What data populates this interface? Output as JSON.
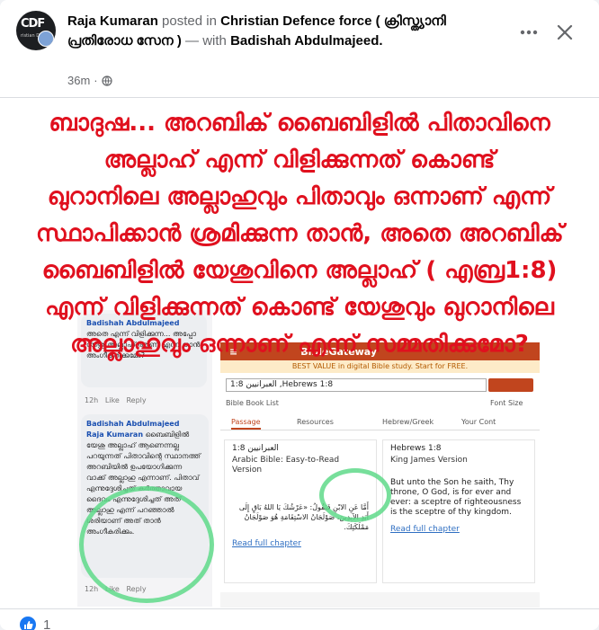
{
  "post": {
    "author": "Raja Kumaran",
    "posted_in_label": "posted in",
    "group_name": "Christian Defence force ( ക്രിസ്ത്യാനി പ്രതിരോധ സേന )",
    "with_label": "— with",
    "tagged": "Badishah Abdulmajeed.",
    "time": "36m",
    "privacy_icon": "globe-icon",
    "avatar_logo_text": "CDF",
    "avatar_logo_sub": "ristian Defen",
    "more_icon": "more-dots-icon",
    "close_icon": "close-icon"
  },
  "image": {
    "headline_lines": [
      "ബാദുഷ... അറബിക് ബൈബിളിൽ പിതാവിനെ",
      "അല്ലാഹ് എന്ന് വിളിക്കുന്നത് കൊണ്ട്",
      "ഖുറാനിലെ അല്ലാഹുവും പിതാവും ഒന്നാണ് എന്ന്",
      "സ്ഥാപിക്കാൻ ശ്രമിക്കുന്ന താൻ, അതെ അറബിക്",
      "ബൈബിളിൽ യേശുവിനെ അല്ലാഹ് ( എബ്ര1:8)",
      "എന്ന് വിളിക്കുന്നത് കൊണ്ട് യേശുവും ഖുറാനിലെ",
      "അല്ലാഹുവും ഒന്നാണ് എന്ന് സമ്മതിക്കുമോ?"
    ],
    "headline_color": "#e0101e",
    "comment1": {
      "name": "Badishah Abdulmajeed",
      "text": "അതെ എന്ന് വിളിക്കുന്ന... അപ്പോ യേശു അല്ലാഹ് ആണ് എന്ന് താൻ അംഗീകരിക്കുമോ?",
      "time": "12h",
      "like": "Like",
      "reply": "Reply"
    },
    "comment2": {
      "name": "Badishah Abdulmajeed",
      "tag": "Raja Kumaran",
      "text": "ബൈബിളിൽ യേശു അല്ലാഹ് ആണെന്നല്ല പറയുന്നത് പിതാവിന്റെ സ്ഥാനത്ത് അറബിയിൽ ഉപയോഗിക്കുന്ന വാക്ക് അല്ലാഹു എന്നാണ്. പിതാവ് എന്നുദ്ദേശിച്ചത് കർത്താവായ ദൈവം എന്നുദ്ദേശിച്ചത് അത് അല്ലാഹു എന്ന് പറഞ്ഞാൽ ശരിയാണ് അത് താൻ അംഗീകരിക്കും.",
      "time": "12h",
      "like": "Like",
      "reply": "Reply"
    },
    "biblegateway": {
      "brand": "BibleGateway",
      "promo": "BEST VALUE in digital Bible study. Start for FREE.",
      "search_value": "العبرانيين 1:8 ,Hebrews 1:8",
      "book_list": "Bible Book List",
      "font_size": "Font Size",
      "tabs": [
        "Passage",
        "Resources",
        "Hebrew/Greek",
        "Your Cont"
      ],
      "left_ref": "العبرانيين 1:8",
      "left_version": "Arabic Bible: Easy-to-Read Version",
      "left_text": "أَمَّا عَنِ الابْنِ فَيَقُولُ: «عَرْشُكَ يَا اللهُ بَاقٍ إِلَى أَبَدِ الآبِدِينَ، صَوْلَجَانُ الاسْتِقَامَةِ هُوَ صَوْلَجَانُ مَمْلَكَتِكَ.",
      "right_ref": "Hebrews 1:8",
      "right_version": "King James Version",
      "right_text": "But unto the Son he saith, Thy throne, O God, is for ever and ever: a sceptre of righteousness is the sceptre of thy kingdom.",
      "read_full": "Read full chapter"
    }
  },
  "footer": {
    "reaction_icon": "like-icon",
    "reaction_count": "1",
    "like_color": "#1877f2"
  }
}
